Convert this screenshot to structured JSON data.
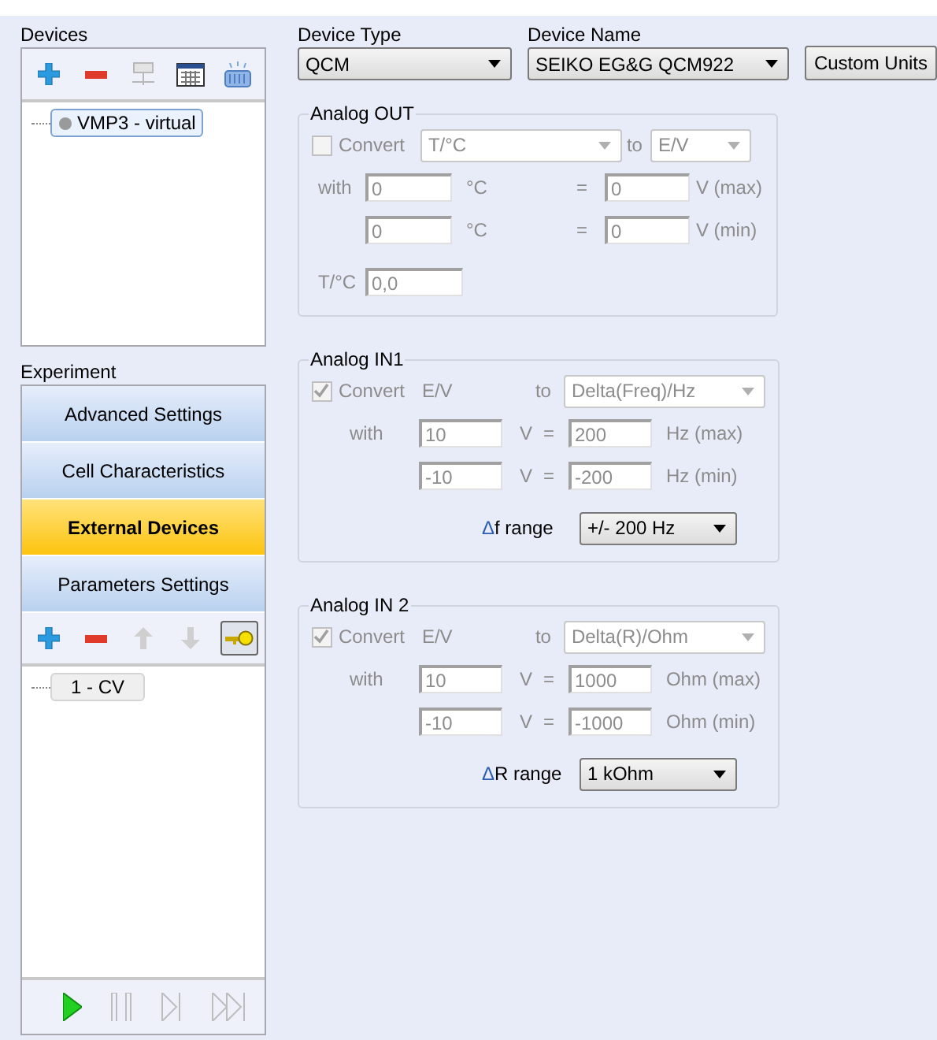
{
  "devices": {
    "label": "Devices",
    "tree": [
      {
        "label": "VMP3 - virtual",
        "selected": true
      }
    ]
  },
  "experiment": {
    "label": "Experiment",
    "key_toggle": {
      "on": true
    },
    "nav": [
      {
        "label": "Advanced Settings",
        "selected": false
      },
      {
        "label": "Cell Characteristics",
        "selected": false
      },
      {
        "label": "External Devices",
        "selected": true
      },
      {
        "label": "Parameters Settings",
        "selected": false
      }
    ],
    "steps": [
      {
        "label": "1 - CV",
        "selected": false
      }
    ]
  },
  "device_type": {
    "label": "Device Type",
    "value": "QCM"
  },
  "device_name": {
    "label": "Device Name",
    "value": "SEIKO EG&G QCM922"
  },
  "custom_units": "Custom Units",
  "analog_out": {
    "title": "Analog OUT",
    "convert": {
      "label": "Convert",
      "checked": false
    },
    "from": "T/°C",
    "to_label": "to",
    "to": "E/V",
    "with_label": "with",
    "rows": [
      {
        "input": "0",
        "unit": "°C",
        "eq": "=",
        "output": "0",
        "output_unit": "V (max)"
      },
      {
        "input": "0",
        "unit": "°C",
        "eq": "=",
        "output": "0",
        "output_unit": "V (min)"
      }
    ],
    "t_label": "T/°C",
    "t_value": "0,0"
  },
  "analog_in": [
    {
      "title": "Analog IN1",
      "convert": {
        "label": "Convert",
        "checked": true
      },
      "source": "E/V",
      "to_label": "to",
      "target": "Delta(Freq)/Hz",
      "with_label": "with",
      "rows": [
        {
          "input": "10",
          "unit": "V",
          "eq": "=",
          "output": "200",
          "output_unit": "Hz (max)"
        },
        {
          "input": "-10",
          "unit": "V",
          "eq": "=",
          "output": "-200",
          "output_unit": "Hz (min)"
        }
      ],
      "range_symbol": "Δ",
      "range_label": "f range",
      "range_value": "+/- 200 Hz"
    },
    {
      "title": "Analog IN 2",
      "convert": {
        "label": "Convert",
        "checked": true
      },
      "source": "E/V",
      "to_label": "to",
      "target": "Delta(R)/Ohm",
      "with_label": "with",
      "rows": [
        {
          "input": "10",
          "unit": "V",
          "eq": "=",
          "output": "1000",
          "output_unit": "Ohm (max)"
        },
        {
          "input": "-10",
          "unit": "V",
          "eq": "=",
          "output": "-1000",
          "output_unit": "Ohm (min)"
        }
      ],
      "range_symbol": "Δ",
      "range_label": "R range",
      "range_value": "1 kOhm"
    }
  ]
}
